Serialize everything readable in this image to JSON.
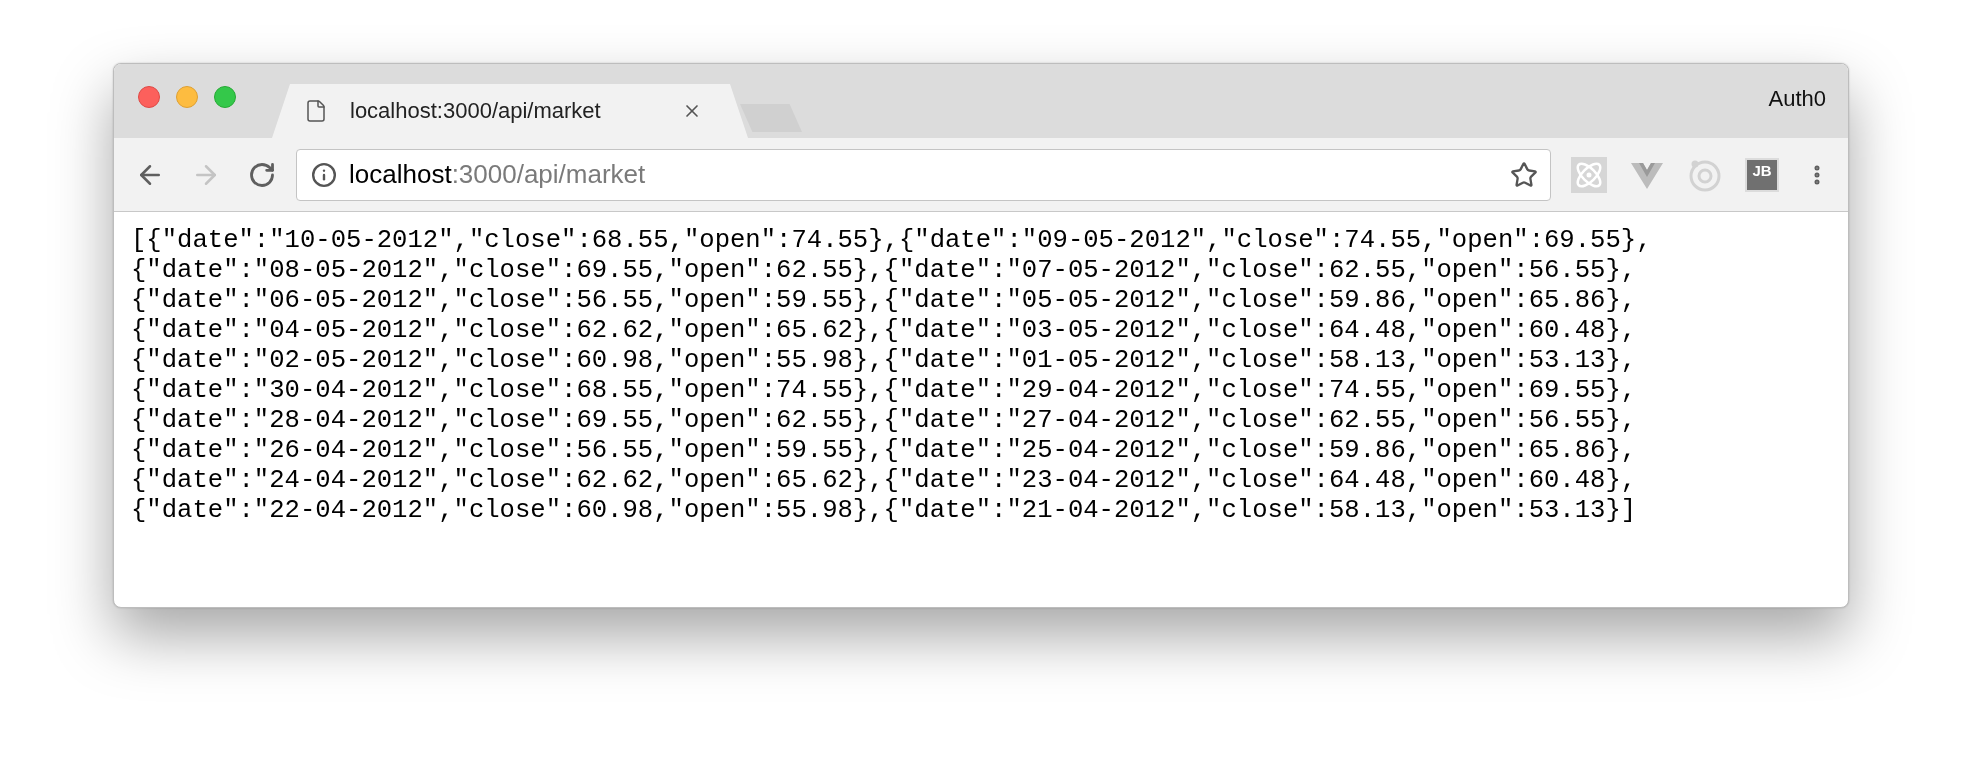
{
  "tab": {
    "title": "localhost:3000/api/market"
  },
  "profile": "Auth0",
  "address": {
    "host": "localhost",
    "path": ":3000/api/market"
  },
  "extensions": [
    {
      "kind": "atom"
    },
    {
      "kind": "vee"
    },
    {
      "kind": "ring"
    },
    {
      "kind": "badge",
      "label": "JB"
    }
  ],
  "body_lines": [
    "[{\"date\":\"10-05-2012\",\"close\":68.55,\"open\":74.55},{\"date\":\"09-05-2012\",\"close\":74.55,\"open\":69.55},",
    "{\"date\":\"08-05-2012\",\"close\":69.55,\"open\":62.55},{\"date\":\"07-05-2012\",\"close\":62.55,\"open\":56.55},",
    "{\"date\":\"06-05-2012\",\"close\":56.55,\"open\":59.55},{\"date\":\"05-05-2012\",\"close\":59.86,\"open\":65.86},",
    "{\"date\":\"04-05-2012\",\"close\":62.62,\"open\":65.62},{\"date\":\"03-05-2012\",\"close\":64.48,\"open\":60.48},",
    "{\"date\":\"02-05-2012\",\"close\":60.98,\"open\":55.98},{\"date\":\"01-05-2012\",\"close\":58.13,\"open\":53.13},",
    "{\"date\":\"30-04-2012\",\"close\":68.55,\"open\":74.55},{\"date\":\"29-04-2012\",\"close\":74.55,\"open\":69.55},",
    "{\"date\":\"28-04-2012\",\"close\":69.55,\"open\":62.55},{\"date\":\"27-04-2012\",\"close\":62.55,\"open\":56.55},",
    "{\"date\":\"26-04-2012\",\"close\":56.55,\"open\":59.55},{\"date\":\"25-04-2012\",\"close\":59.86,\"open\":65.86},",
    "{\"date\":\"24-04-2012\",\"close\":62.62,\"open\":65.62},{\"date\":\"23-04-2012\",\"close\":64.48,\"open\":60.48},",
    "{\"date\":\"22-04-2012\",\"close\":60.98,\"open\":55.98},{\"date\":\"21-04-2012\",\"close\":58.13,\"open\":53.13}]"
  ]
}
